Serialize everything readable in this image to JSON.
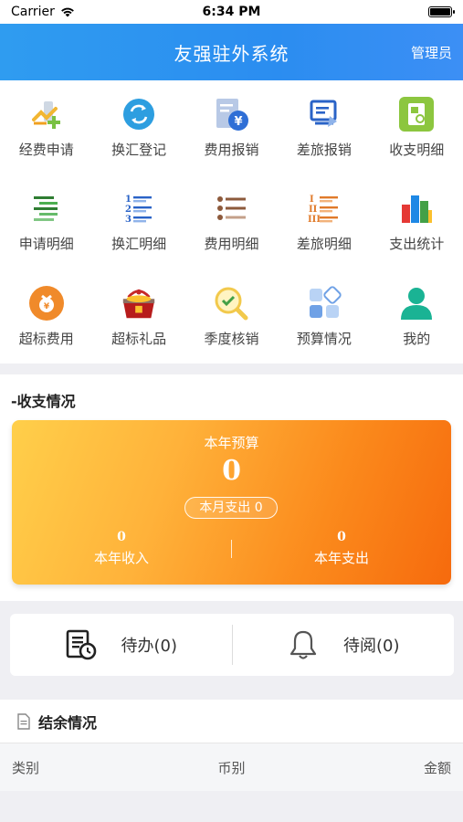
{
  "status_bar": {
    "carrier": "Carrier",
    "time": "6:34 PM"
  },
  "header": {
    "title": "友强驻外系统",
    "admin": "管理员",
    "gradient": [
      "#2f9cf0",
      "#3c8ff5"
    ]
  },
  "grid": [
    {
      "label": "经费申请",
      "icon": "fund-apply-icon"
    },
    {
      "label": "换汇登记",
      "icon": "exchange-icon"
    },
    {
      "label": "费用报销",
      "icon": "expense-reimburse-icon"
    },
    {
      "label": "差旅报销",
      "icon": "travel-reimburse-icon"
    },
    {
      "label": "收支明细",
      "icon": "income-detail-icon"
    },
    {
      "label": "申请明细",
      "icon": "apply-detail-icon"
    },
    {
      "label": "换汇明细",
      "icon": "exchange-detail-icon"
    },
    {
      "label": "费用明细",
      "icon": "expense-detail-icon"
    },
    {
      "label": "差旅明细",
      "icon": "travel-detail-icon"
    },
    {
      "label": "支出统计",
      "icon": "bar-chart-icon"
    },
    {
      "label": "超标费用",
      "icon": "over-cost-icon"
    },
    {
      "label": "超标礼品",
      "icon": "gift-basket-icon"
    },
    {
      "label": "季度核销",
      "icon": "magnifier-check-icon"
    },
    {
      "label": "预算情况",
      "icon": "budget-grid-icon"
    },
    {
      "label": "我的",
      "icon": "user-icon"
    }
  ],
  "income": {
    "title": "-收支情况",
    "budget_label": "本年预算",
    "budget_value": "0",
    "month_spend": "本月支出 0",
    "year_income_value": "0",
    "year_income_label": "本年收入",
    "year_spend_value": "0",
    "year_spend_label": "本年支出"
  },
  "todo": {
    "pending": "待办(0)",
    "to_read": "待阅(0)"
  },
  "balance": {
    "title": "结余情况",
    "columns": [
      "类别",
      "币别",
      "金额"
    ]
  }
}
